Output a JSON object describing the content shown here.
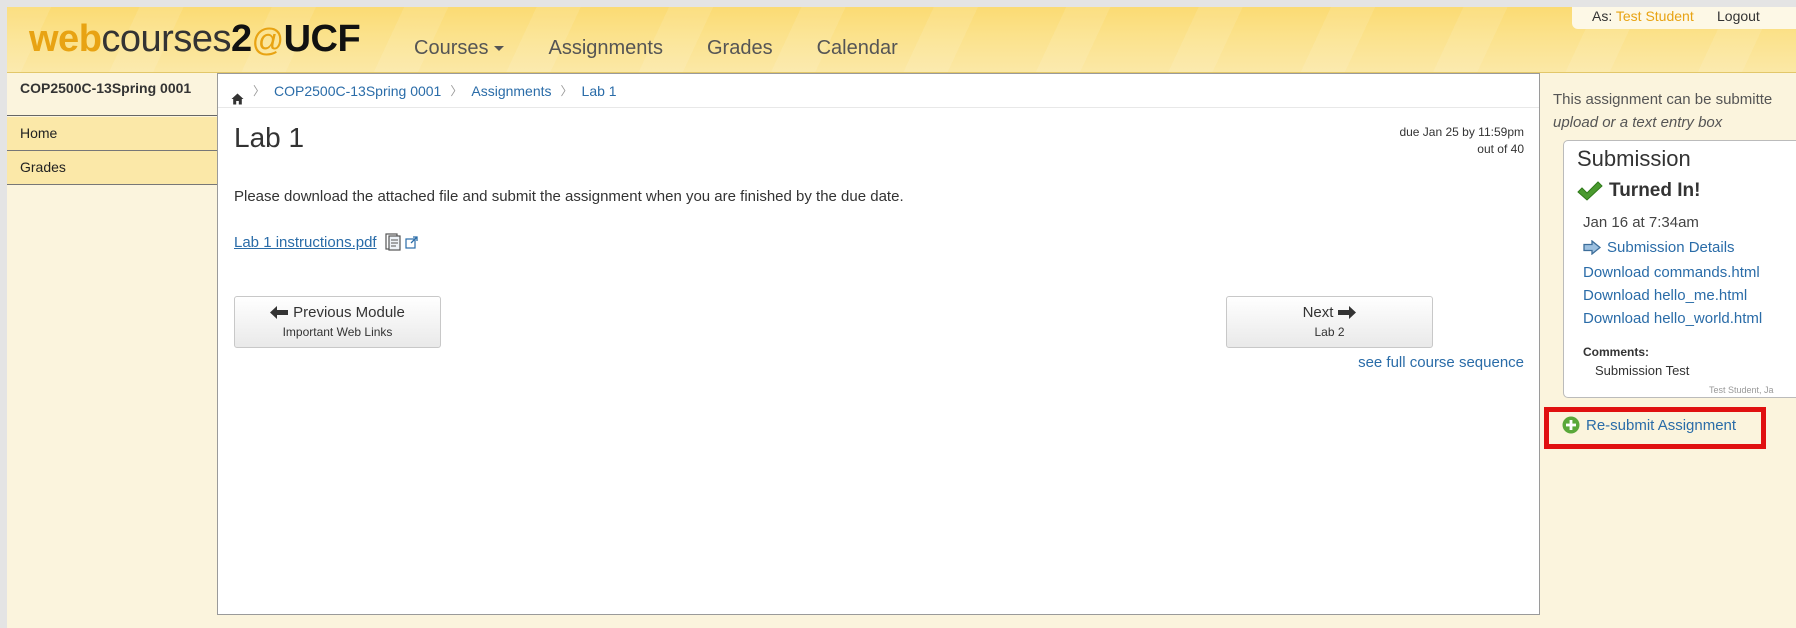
{
  "header": {
    "logo": {
      "web": "web",
      "courses": "courses",
      "two": "2",
      "at": "@",
      "ucf": "UCF"
    },
    "nav": [
      {
        "label": "Courses"
      },
      {
        "label": "Assignments"
      },
      {
        "label": "Grades"
      },
      {
        "label": "Calendar"
      }
    ],
    "user": {
      "prefix": "As:",
      "name": "Test Student",
      "logout": "Logout"
    }
  },
  "sidebar": {
    "course": "COP2500C-13Spring 0001",
    "items": [
      {
        "label": "Home"
      },
      {
        "label": "Grades"
      }
    ]
  },
  "breadcrumb": {
    "course": "COP2500C-13Spring 0001",
    "section": "Assignments",
    "current": "Lab 1"
  },
  "assignment": {
    "title": "Lab 1",
    "due": "due Jan 25 by 11:59pm",
    "points": "out of 40",
    "description": "Please download the attached file and submit the assignment when you are finished by the due date.",
    "file": "Lab 1 instructions.pdf"
  },
  "module_nav": {
    "prev_label": "Previous Module",
    "prev_sub": "Important Web Links",
    "next_label": "Next",
    "next_sub": "Lab 2",
    "full_sequence": "see full course sequence"
  },
  "right_sidebar": {
    "note_line1": "This assignment can be submitte",
    "note_line2": "upload or a text entry box",
    "submission": {
      "header": "Submission",
      "status": "Turned In!",
      "date": "Jan 16 at 7:34am",
      "details": "Submission Details",
      "downloads": [
        {
          "label": "Download commands.html"
        },
        {
          "label": "Download hello_me.html"
        },
        {
          "label": "Download hello_world.html"
        }
      ],
      "comments_label": "Comments:",
      "comment_text": "Submission Test",
      "comment_meta": "Test Student, Ja"
    },
    "resubmit": "Re-submit Assignment"
  },
  "colors": {
    "accent_gold": "#e8a313",
    "link": "#2a6ca8",
    "highlight": "#e01010",
    "check": "#4a9a2f"
  },
  "icons": [
    "home-icon",
    "pdf-preview-icon",
    "external-link-icon",
    "arrow-left-icon",
    "arrow-right-icon",
    "checkmark-icon",
    "arrow-right-outline-icon",
    "plus-circle-icon"
  ]
}
